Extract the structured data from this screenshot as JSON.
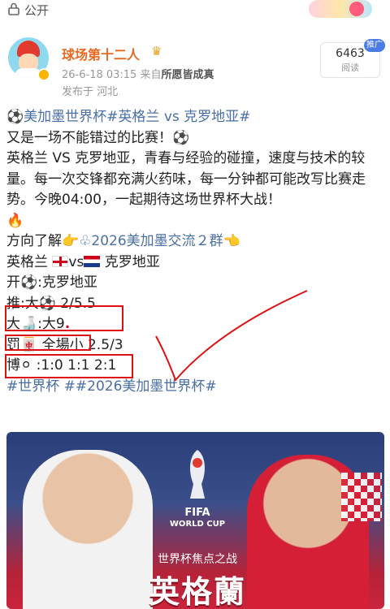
{
  "topbar": {
    "visibility_label": "公开",
    "lock_icon": "lock-icon"
  },
  "author": {
    "name": "球场第十二人",
    "avatar_icon": "avatar",
    "badge_icon": "crown-icon",
    "timestamp": "26-6-18 03:15",
    "source_prefix": "来自",
    "source": "所愿皆成真",
    "location": "发布于 河北"
  },
  "views": {
    "count": "6463",
    "unit": "阅读",
    "promo_badge": "推广"
  },
  "post": {
    "hashtag_title": "⚽美加墨世界杯#英格兰 vs 克罗地亚#",
    "line1": "又是一场不能错过的比赛！⚽",
    "para": "英格兰 VS 克罗地亚，青春与经验的碰撞，速度与技术的较量。每一次交锋都充满火药味，每一分钟都可能改写比赛走势。今晚04:00，一起期待这场世界杯大战！",
    "fire": "🔥",
    "group_line_prefix": "方向了解👉",
    "group_line_link": "♧2026美加墨交流２群",
    "group_line_suffix": "👈",
    "team_home": "英格兰",
    "vs": "vs",
    "team_away": "克罗地亚",
    "open_label": "开⚽:克罗地亚",
    "tip_label": "推:大⚽ 2/5.5",
    "big_label": "大🍶:大9",
    "penalty_label": "罚🀄 全場小 2.5/3",
    "bo_label": "博⚪ :1:0 1:1  2:1",
    "tags": "#世界杯 ##2026美加墨世界杯#"
  },
  "banner": {
    "fifa": "FIFA",
    "world_cup": "WORLD CUP",
    "focus": "世界杯焦点之战",
    "title": "英格蘭"
  },
  "colors": {
    "hashtag": "#4a6fa5",
    "accent": "#e86a20",
    "highlight_box": "#d11111"
  }
}
